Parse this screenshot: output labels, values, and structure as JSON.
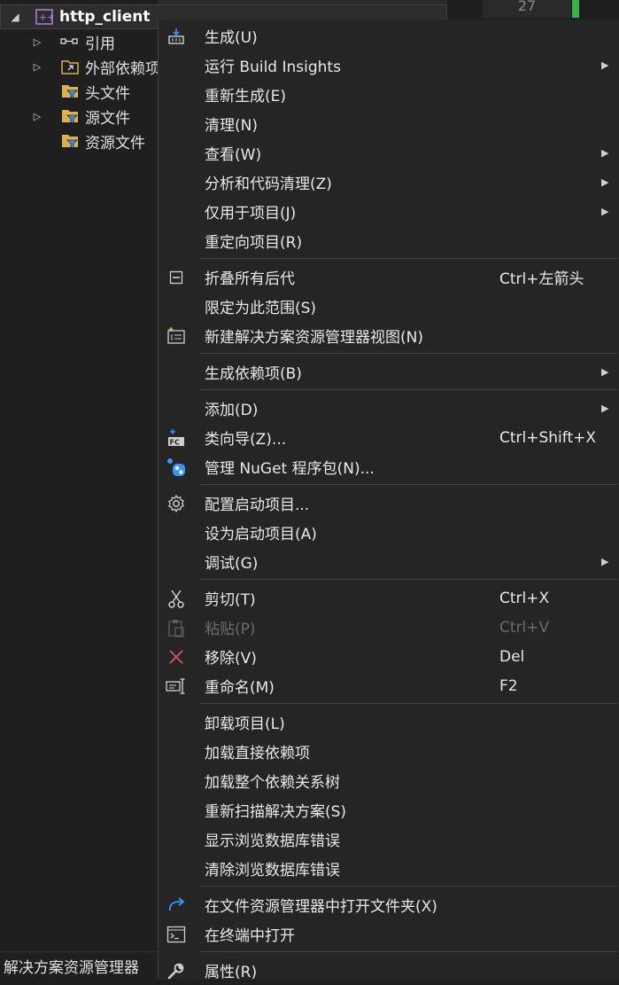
{
  "explorer": {
    "project": "http_client",
    "items": [
      {
        "label": "引用",
        "expand": "▷"
      },
      {
        "label": "外部依赖项",
        "expand": "▷"
      },
      {
        "label": "头文件",
        "expand": ""
      },
      {
        "label": "源文件",
        "expand": "▷"
      },
      {
        "label": "资源文件",
        "expand": ""
      }
    ],
    "footer_tab": "解决方案资源管理器",
    "editor_line": "27"
  },
  "menu": {
    "groups": [
      [
        {
          "label": "生成(U)",
          "icon": "build-icon"
        },
        {
          "label": "运行 Build Insights",
          "submenu": true
        },
        {
          "label": "重新生成(E)"
        },
        {
          "label": "清理(N)"
        },
        {
          "label": "查看(W)",
          "submenu": true
        },
        {
          "label": "分析和代码清理(Z)",
          "submenu": true
        },
        {
          "label": "仅用于项目(J)",
          "submenu": true
        },
        {
          "label": "重定向项目(R)"
        }
      ],
      [
        {
          "label": "折叠所有后代",
          "shortcut": "Ctrl+左箭头",
          "icon": "collapse-icon"
        },
        {
          "label": "限定为此范围(S)"
        },
        {
          "label": "新建解决方案资源管理器视图(N)",
          "icon": "new-view-icon"
        }
      ],
      [
        {
          "label": "生成依赖项(B)",
          "submenu": true
        }
      ],
      [
        {
          "label": "添加(D)",
          "submenu": true
        },
        {
          "label": "类向导(Z)...",
          "shortcut": "Ctrl+Shift+X",
          "icon": "class-wizard-icon"
        },
        {
          "label": "管理 NuGet 程序包(N)...",
          "icon": "nuget-icon"
        }
      ],
      [
        {
          "label": "配置启动项目...",
          "icon": "gear-icon"
        },
        {
          "label": "设为启动项目(A)"
        },
        {
          "label": "调试(G)",
          "submenu": true
        }
      ],
      [
        {
          "label": "剪切(T)",
          "shortcut": "Ctrl+X",
          "icon": "scissors-icon"
        },
        {
          "label": "粘贴(P)",
          "shortcut": "Ctrl+V",
          "icon": "paste-icon",
          "disabled": true
        },
        {
          "label": "移除(V)",
          "shortcut": "Del",
          "icon": "remove-icon"
        },
        {
          "label": "重命名(M)",
          "shortcut": "F2",
          "icon": "rename-icon"
        }
      ],
      [
        {
          "label": "卸载项目(L)"
        },
        {
          "label": "加载直接依赖项"
        },
        {
          "label": "加载整个依赖关系树"
        },
        {
          "label": "重新扫描解决方案(S)"
        },
        {
          "label": "显示浏览数据库错误"
        },
        {
          "label": "清除浏览数据库错误"
        }
      ],
      [
        {
          "label": "在文件资源管理器中打开文件夹(X)",
          "icon": "open-folder-icon"
        },
        {
          "label": "在终端中打开",
          "icon": "terminal-icon"
        }
      ],
      [
        {
          "label": "属性(R)",
          "icon": "wrench-icon"
        }
      ]
    ]
  },
  "colors": {
    "menu_bg": "#252526",
    "separator": "#454545",
    "text": "#e8e8e8",
    "disabled_text": "#6a6a6a",
    "remove_red": "#e05555",
    "accent_blue": "#3794ff",
    "folder_yellow": "#dcb04a",
    "project_purple": "#b180d7"
  }
}
